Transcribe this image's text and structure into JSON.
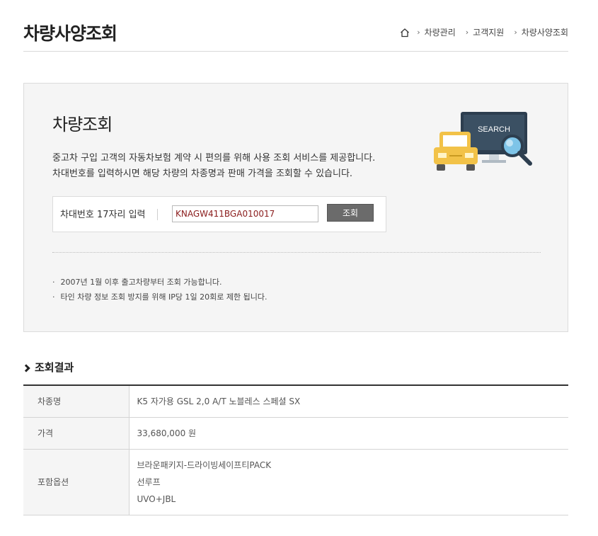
{
  "header": {
    "title": "차량사양조회",
    "breadcrumb": [
      "차량관리",
      "고객지원",
      "차량사양조회"
    ]
  },
  "lookup": {
    "title": "차량조회",
    "description": [
      "중고차 구입 고객의 자동차보험 계약 시 편의를 위해 사용 조회 서비스를 제공합니다.",
      "차대번호를 입력하시면 해당 차량의 차종명과 판매 가격을 조회할 수 있습니다."
    ],
    "illustration_label": "SEARCH",
    "form": {
      "label": "차대번호 17자리 입력",
      "input_value": "KNAGW411BGA010017",
      "button_label": "조회"
    },
    "notes": [
      "2007년 1월 이후 출고차량부터 조회 가능합니다.",
      "타인 차량 정보 조회 방지를 위해 IP당 1일 20회로 제한 됩니다."
    ]
  },
  "result": {
    "title": "조회결과",
    "rows": [
      {
        "label": "차종명",
        "value": "K5 자가용 GSL 2,0 A/T 노블레스 스페셜 SX"
      },
      {
        "label": "가격",
        "value": "33,680,000 원"
      },
      {
        "label": "포함옵션",
        "options": [
          "브라운패키지-드라이빙세이프티PACK",
          "선루프",
          "UVO+JBL"
        ]
      }
    ]
  }
}
